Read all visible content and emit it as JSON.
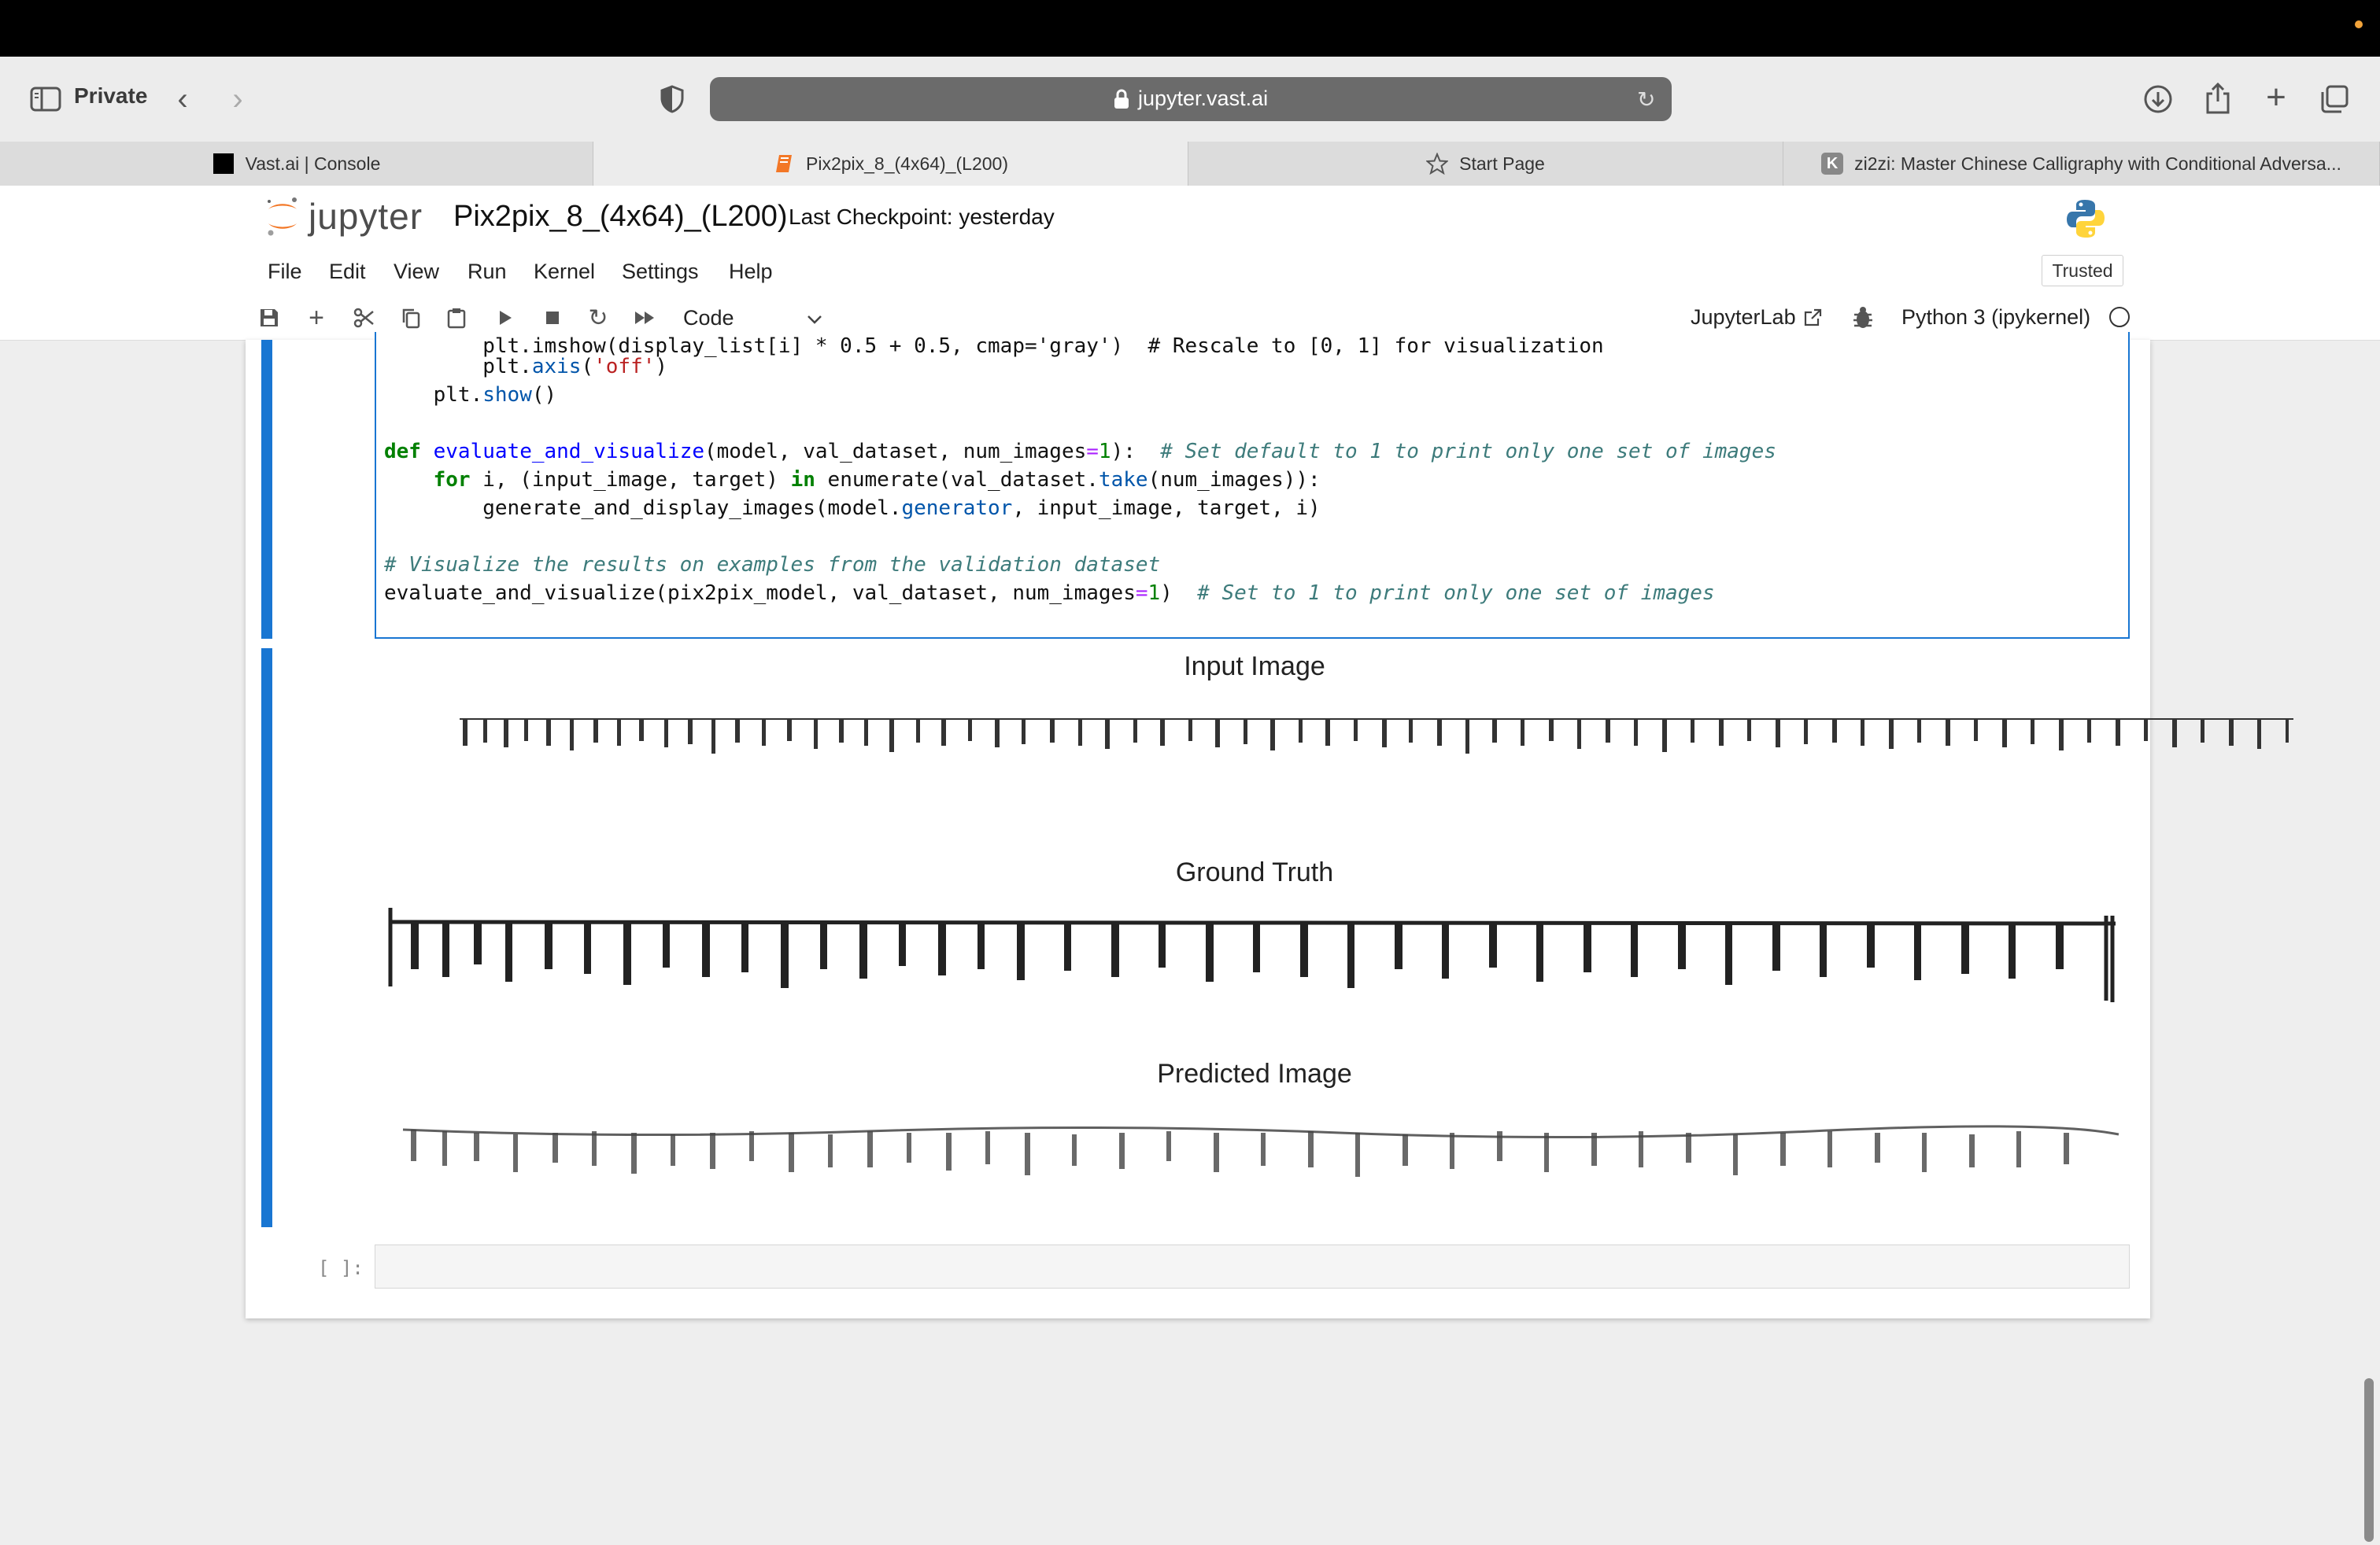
{
  "browser": {
    "private_label": "Private",
    "url": "jupyter.vast.ai",
    "tabs": [
      {
        "label": "Vast.ai | Console"
      },
      {
        "label": "Pix2pix_8_(4x64)_(L200)"
      },
      {
        "label": "Start Page"
      },
      {
        "label": "zi2zi: Master Chinese Calligraphy with Conditional Adversa..."
      }
    ],
    "tab4_badge": "K"
  },
  "jupyter": {
    "logo_text": "jupyter",
    "notebook_title": "Pix2pix_8_(4x64)_(L200)",
    "checkpoint": "Last Checkpoint: yesterday",
    "menu": [
      "File",
      "Edit",
      "View",
      "Run",
      "Kernel",
      "Settings",
      "Help"
    ],
    "trusted": "Trusted",
    "cell_type": "Code",
    "jupyterlab_link": "JupyterLab",
    "kernel": "Python 3 (ipykernel)"
  },
  "code_lines": [
    "        plt.imshow(display_list[i] * 0.5 + 0.5, cmap='gray')  # Rescale to [0, 1] for visualization",
    "        plt.axis('off')",
    "    plt.show()",
    "",
    "def evaluate_and_visualize(model, val_dataset, num_images=1):  # Set default to 1 to print only one set of images",
    "    for i, (input_image, target) in enumerate(val_dataset.take(num_images)):",
    "        generate_and_display_images(model.generator, input_image, target, i)",
    "",
    "# Visualize the results on examples from the validation dataset",
    "evaluate_and_visualize(pix2pix_model, val_dataset, num_images=1)  # Set to 1 to print only one set of images"
  ],
  "output": {
    "titles": [
      "Input Image",
      "Ground Truth",
      "Predicted Image"
    ]
  },
  "empty_cell_prompt": "[ ]:",
  "colors": {
    "accent": "#1976d2",
    "jupyter_orange": "#f37726"
  }
}
